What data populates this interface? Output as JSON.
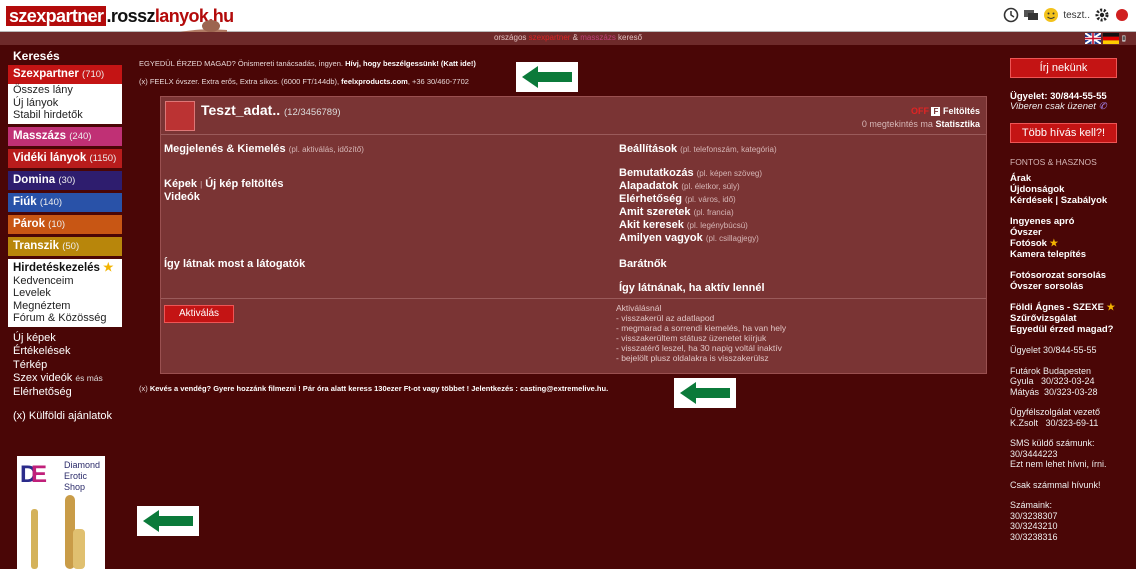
{
  "header": {
    "logo_part1": "szexpartner",
    "logo_part2": ".rossz",
    "logo_part3": "lanyok.hu",
    "user_label": "teszt..",
    "subbar_prefix": "országos",
    "subbar_red": "szexpartner",
    "subbar_amp": "&",
    "subbar_pink": "masszázs",
    "subbar_suffix": "kereső"
  },
  "sidebar": {
    "title": "Keresés",
    "categories": [
      {
        "label": "Szexpartner",
        "count": "(710)",
        "color": "#c41414"
      },
      {
        "label": "Masszázs",
        "count": "(240)",
        "color": "#c03075"
      },
      {
        "label": "Vidéki lányok",
        "count": "(1150)",
        "color": "#b81c1c"
      },
      {
        "label": "Domina",
        "count": "(30)",
        "color": "#2e1d6e"
      },
      {
        "label": "Fiúk",
        "count": "(140)",
        "color": "#2952a8"
      },
      {
        "label": "Párok",
        "count": "(10)",
        "color": "#c85614"
      },
      {
        "label": "Transzik",
        "count": "(50)",
        "color": "#b8860b"
      }
    ],
    "szexpartner_items": [
      "Összes lány",
      "Új lányok",
      "Stabil hirdetők"
    ],
    "account_header": "Hirdetéskezelés",
    "account_items": [
      "Kedvenceim",
      "Levelek",
      "Megnéztem",
      "Fórum & Közösség"
    ],
    "links": [
      "Új képek",
      "Értékelések",
      "Térkép"
    ],
    "videos_label": "Szex videók",
    "videos_suffix": "és más",
    "availability": "Elérhetőség",
    "foreign_offers": "(x) Külföldi ajánlatok",
    "promo_line1": "Diamond",
    "promo_line2": "Erotic",
    "promo_line3": "Shop"
  },
  "ads": {
    "line1_a": "EGYEDÜL ÉRZED MAGAD?",
    "line1_b": " Önismereti tanácsadás, ingyen. ",
    "line1_c": "Hívj, hogy beszélgessünk! (Katt ide!)",
    "line2_a": "(x) FEELX óvszer. Extra erős, Extra síkos. (6000 FT/144db), ",
    "line2_b": "feelxproducts.com",
    "line2_c": ", +36 30/460-7702",
    "line3_a": "(x) ",
    "line3_b": "Kevés a vendég? Gyere hozzánk filmezni ! Pár óra alatt keress 130ezer Ft-ot vagy többet ! Jelentkezés : casting@extremelive.hu."
  },
  "panel": {
    "title": "Teszt_adat..",
    "id": "(12/3456789)",
    "status_off": "OFF",
    "upload": "Feltöltés",
    "highlight_text": "0 megtekintés ma",
    "statistics": "Statisztika",
    "left": [
      {
        "label": "Megjelenés & Kiemelés",
        "hint": "(pl. aktiválás, időzítő)"
      },
      {
        "label": "Képek",
        "hint": ""
      },
      {
        "label": "Új kép feltöltés",
        "hint": ""
      },
      {
        "label": "Videók",
        "hint": ""
      },
      {
        "label": "Így látnak most a látogatók",
        "hint": ""
      }
    ],
    "right": [
      {
        "label": "Beállítások",
        "hint": "(pl. telefonszám, kategória)"
      },
      {
        "label": "Bemutatkozás",
        "hint": "(pl. képen szöveg)"
      },
      {
        "label": "Alapadatok",
        "hint": "(pl. életkor, súly)"
      },
      {
        "label": "Elérhetőség",
        "hint": "(pl. város, idő)"
      },
      {
        "label": "Amit szeretek",
        "hint": "(pl. francia)"
      },
      {
        "label": "Akit keresek",
        "hint": "(pl. legénybúcsú)"
      },
      {
        "label": "Amilyen vagyok",
        "hint": "(pl. csillagjegy)"
      },
      {
        "label": "Barátnők",
        "hint": ""
      },
      {
        "label": "Így látnának, ha aktív lennél",
        "hint": ""
      }
    ],
    "activate_button": "Aktiválás",
    "activation_notes": [
      "Aktiválásnál",
      "- visszakerül az adatlapod",
      "- megmarad a sorrendi kiemelés, ha van hely",
      "- visszakerültem státusz üzenetet kiírjuk",
      "- visszatérő leszel, ha 30 napig voltál inaktív",
      "- bejelölt plusz oldalakra is visszakerülsz"
    ]
  },
  "rightcol": {
    "write_us": "Írj nekünk",
    "duty_phone": "Ügyelet: 30/844-55-55",
    "viber_note": "Viberen csak üzenet",
    "more_calls": "Több hívás kell?!",
    "important_header": "FONTOS & HASZNOS",
    "links1": [
      "Árak",
      "Újdonságok",
      "Kérdések | Szabályok"
    ],
    "links2": [
      "Ingyenes apró",
      "Óvszer",
      "Fotósok",
      "Kamera telepítés"
    ],
    "links3": [
      "Fotósorozat sorsolás",
      "Óvszer sorsolás"
    ],
    "links4": [
      "Földi Ágnes - SZEXE",
      "Szűrővizsgálat",
      "Egyedül érzed magad?"
    ],
    "duty2": "Ügyelet 30/844-55-55",
    "couriers_header": "Futárok Budapesten",
    "couriers": [
      "Gyula   30/323-03-24",
      "Mátyás  30/323-03-28"
    ],
    "support_header": "Ügyfélszolgálat vezető",
    "support": "K.Zsolt   30/323-69-11",
    "sms_header": "SMS küldő számunk:",
    "sms_number": "30/3444223",
    "sms_note": "Ezt nem lehet hívni, írni.",
    "call_note": "Csak számmal hívunk!",
    "numbers_header": "Számaink:",
    "numbers": [
      "30/3238307",
      "30/3243210",
      "30/3238316"
    ]
  },
  "colors": {
    "background": "#4a0606",
    "accent_red": "#c41414",
    "panel": "#7a3434",
    "arrow_green": "#0b7a3a"
  }
}
